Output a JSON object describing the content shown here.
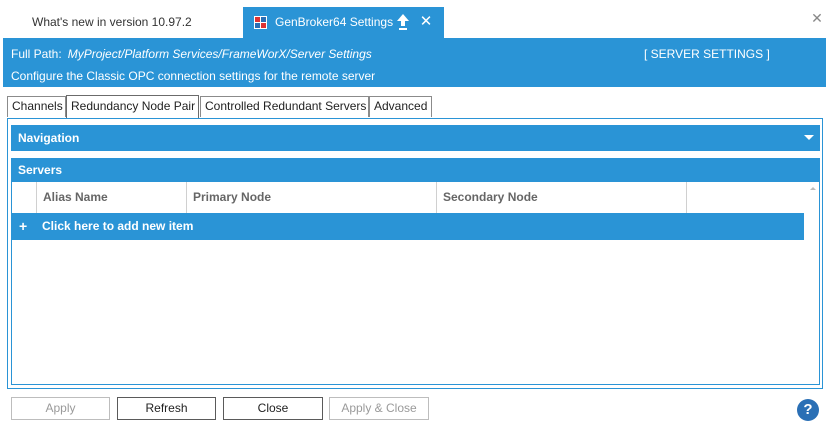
{
  "doc_tabs": {
    "inactive_tab_label": "What's new in version 10.97.2",
    "active_tab_label": "GenBroker64 Settings",
    "active_tab_icon": "genbroker-icon",
    "pin_icon": "pin-up-arrow-icon",
    "close_tab_symbol": "✕",
    "window_close_symbol": "✕"
  },
  "banner": {
    "path_label": "Full Path:",
    "path_value": "MyProject/Platform Services/FrameWorX/Server Settings",
    "section_title": "[ SERVER SETTINGS ]",
    "description": "Configure the Classic OPC connection settings for the remote server"
  },
  "prop_tabs": [
    {
      "label": "Channels",
      "active": false
    },
    {
      "label": "Redundancy Node Pair",
      "active": true
    },
    {
      "label": "Controlled Redundant Servers",
      "active": false
    },
    {
      "label": "Advanced",
      "active": false
    }
  ],
  "navigation": {
    "label": "Navigation"
  },
  "servers": {
    "label": "Servers",
    "columns": [
      "Alias Name",
      "Primary Node",
      "Secondary Node",
      ""
    ],
    "add_row_symbol": "+",
    "add_row_label": "Click here to add new item",
    "rows": []
  },
  "buttons": {
    "apply": "Apply",
    "refresh": "Refresh",
    "close": "Close",
    "apply_close": "Apply & Close",
    "help_symbol": "?"
  },
  "colors": {
    "accent": "#2a94d6",
    "help": "#2a6fb5"
  }
}
